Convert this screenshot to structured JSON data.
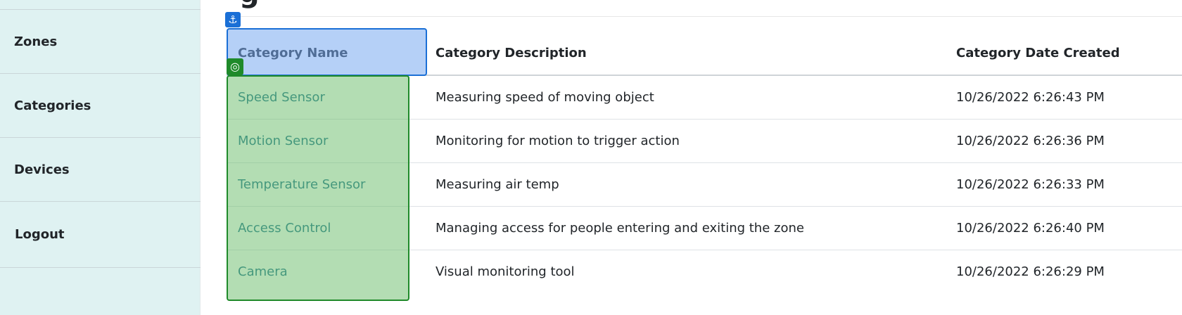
{
  "sidebar": {
    "items": [
      {
        "label": "Zones"
      },
      {
        "label": "Categories"
      },
      {
        "label": "Devices"
      },
      {
        "label": "Logout"
      }
    ]
  },
  "page": {
    "title_fragment": "g"
  },
  "table": {
    "headers": [
      "Category Name",
      "Category Description",
      "Category Date Created"
    ],
    "rows": [
      {
        "name": "Speed Sensor",
        "description": "Measuring speed of moving object",
        "date": "10/26/2022 6:26:43 PM"
      },
      {
        "name": "Motion Sensor",
        "description": "Monitoring for motion to trigger action",
        "date": "10/26/2022 6:26:36 PM"
      },
      {
        "name": "Temperature Sensor",
        "description": "Measuring air temp",
        "date": "10/26/2022 6:26:33 PM"
      },
      {
        "name": "Access Control",
        "description": "Managing access for people entering and exiting the zone",
        "date": "10/26/2022 6:26:40 PM"
      },
      {
        "name": "Camera",
        "description": "Visual monitoring tool",
        "date": "10/26/2022 6:26:29 PM"
      }
    ]
  },
  "overlay": {
    "anchor_icon": "⚓",
    "target_icon": "◎",
    "colors": {
      "anchor": "#1a6fd6",
      "target": "#1f8a2a"
    }
  },
  "colors": {
    "sidebar_bg": "#dff2f2",
    "link": "#1b6f8e"
  }
}
